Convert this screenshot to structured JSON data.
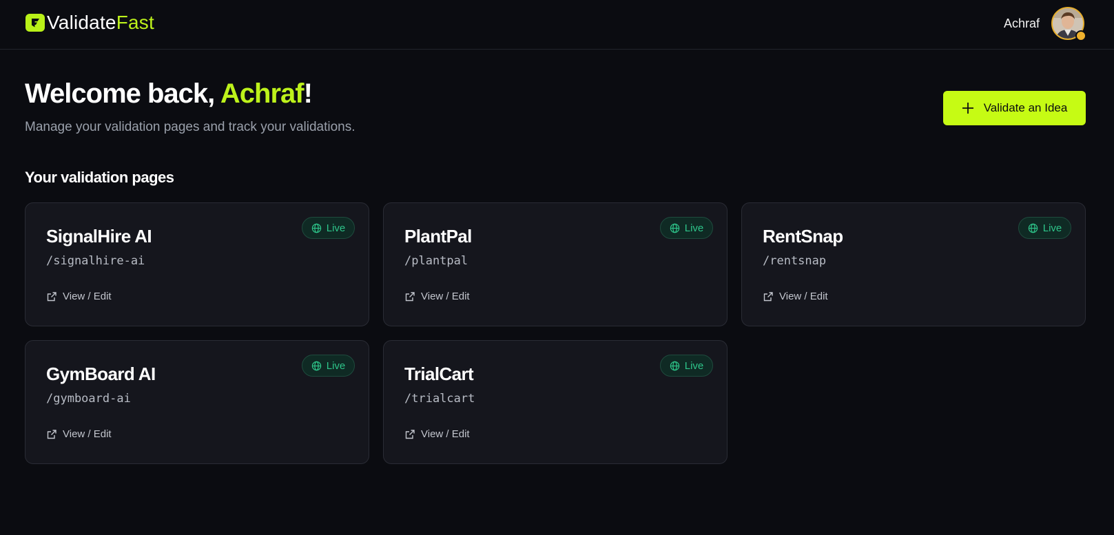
{
  "brand": {
    "name_part1": "Validate",
    "name_part2": "Fast",
    "accent_color": "#bdf21b"
  },
  "user": {
    "name": "Achraf"
  },
  "hero": {
    "title_prefix": "Welcome back, ",
    "title_name": "Achraf",
    "title_suffix": "!",
    "subtitle": "Manage your validation pages and track your validations."
  },
  "cta": {
    "label": "Validate an Idea",
    "icon": "plus-icon",
    "color": "#c6fb14"
  },
  "section": {
    "title": "Your validation pages"
  },
  "cards": [
    {
      "name": "SignalHire AI",
      "slug": "/signalhire-ai",
      "status": "Live",
      "action": "View / Edit"
    },
    {
      "name": "PlantPal",
      "slug": "/plantpal",
      "status": "Live",
      "action": "View / Edit"
    },
    {
      "name": "RentSnap",
      "slug": "/rentsnap",
      "status": "Live",
      "action": "View / Edit"
    },
    {
      "name": "GymBoard AI",
      "slug": "/gymboard-ai",
      "status": "Live",
      "action": "View / Edit"
    },
    {
      "name": "TrialCart",
      "slug": "/trialcart",
      "status": "Live",
      "action": "View / Edit"
    }
  ],
  "colors": {
    "background": "#0b0c11",
    "card": "#15161d",
    "live_green": "#2ec58a"
  }
}
